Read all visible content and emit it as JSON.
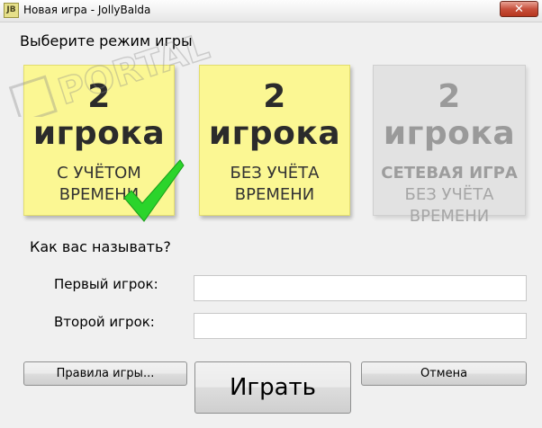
{
  "window": {
    "icon_text": "JB",
    "title": "Новая игра - JollyBalda",
    "close_label": "✕"
  },
  "heading": "Выберите режим игры",
  "modes": [
    {
      "big": "2 игрока",
      "line1": "С УЧЁТОМ",
      "line2": "ВРЕМЕНИ",
      "selected": true
    },
    {
      "big": "2 игрока",
      "line1": "БЕЗ УЧЁТА",
      "line2": "ВРЕМЕНИ",
      "selected": false
    },
    {
      "big": "2 игрока",
      "line1": "СЕТЕВАЯ ИГРА",
      "line2": "БЕЗ УЧЁТА",
      "line3": "ВРЕМЕНИ",
      "enabled": false
    }
  ],
  "players": {
    "prompt": "Как вас называть?",
    "first_label": "Первый игрок:",
    "first_value": "",
    "second_label": "Второй игрок:",
    "second_value": ""
  },
  "buttons": {
    "rules": "Правила игры...",
    "play": "Играть",
    "cancel": "Отмена"
  },
  "watermark": "PORTAL",
  "colors": {
    "card_yellow": "#fbf793",
    "card_gray": "#e2e2e2",
    "check_green": "#2bd42b"
  }
}
